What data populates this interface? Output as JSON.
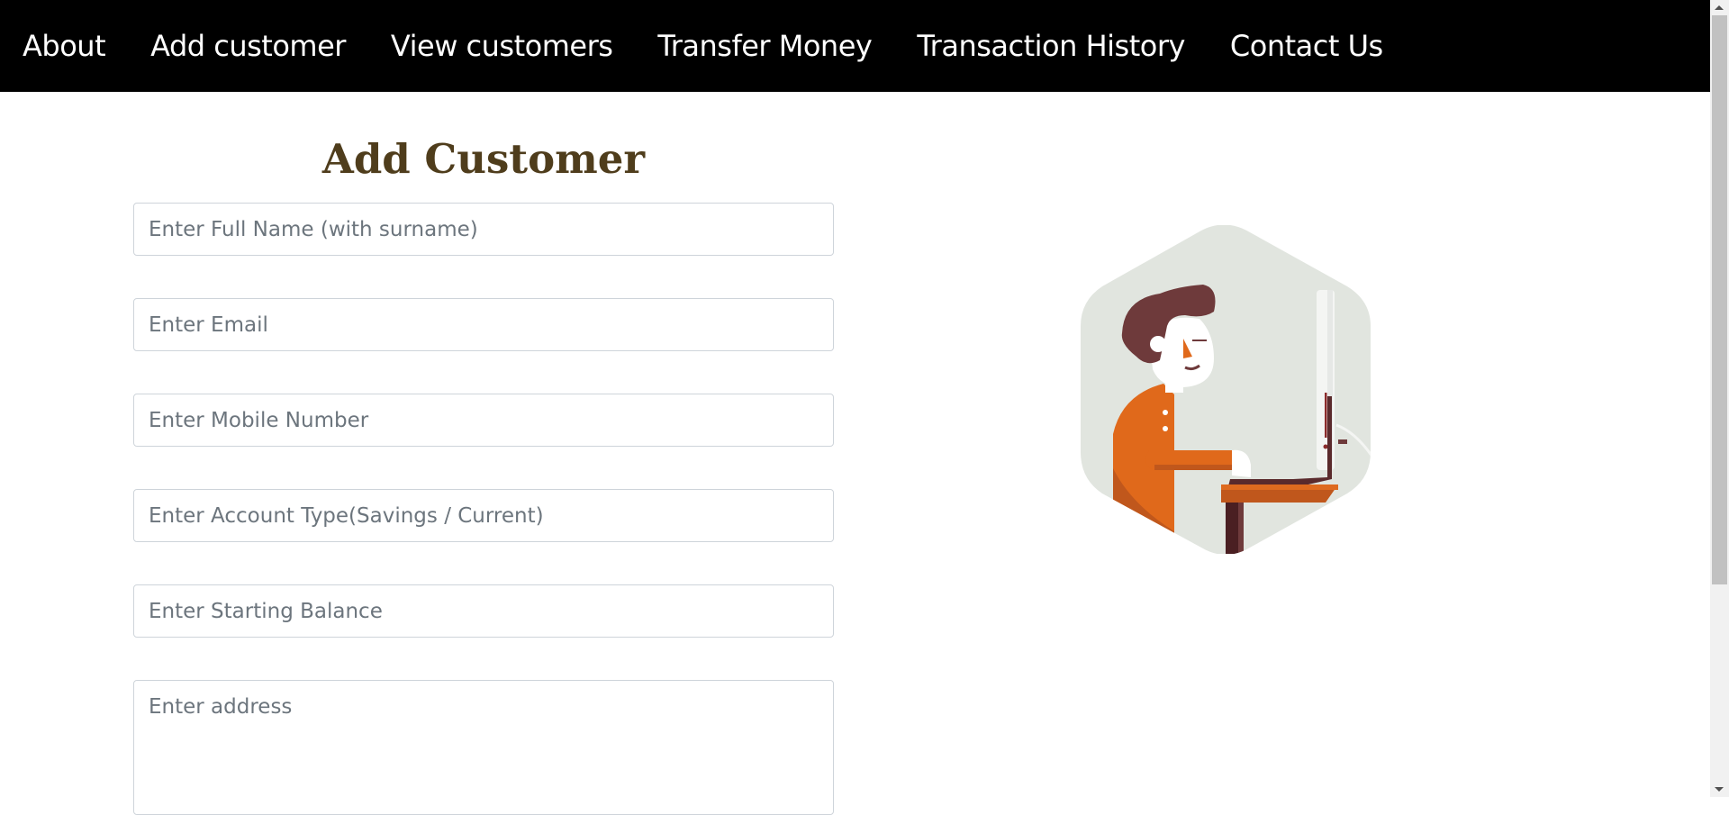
{
  "nav": {
    "items": [
      {
        "label": "About"
      },
      {
        "label": "Add customer"
      },
      {
        "label": "View customers"
      },
      {
        "label": "Transfer Money"
      },
      {
        "label": "Transaction History"
      },
      {
        "label": "Contact Us"
      }
    ]
  },
  "form": {
    "title": "Add Customer",
    "fields": {
      "full_name": {
        "placeholder": "Enter Full Name (with surname)",
        "value": ""
      },
      "email": {
        "placeholder": "Enter Email",
        "value": ""
      },
      "mobile": {
        "placeholder": "Enter Mobile Number",
        "value": ""
      },
      "account_type": {
        "placeholder": "Enter Account Type(Savings / Current)",
        "value": ""
      },
      "starting_balance": {
        "placeholder": "Enter Starting Balance",
        "value": ""
      },
      "address": {
        "placeholder": "Enter address",
        "value": ""
      }
    }
  },
  "illustration": {
    "icon": "person-at-computer-illustration",
    "colors": {
      "background": "#e1e5df",
      "shirt": "#e0691b",
      "hair": "#6e3a3b",
      "desk": "#c0571c",
      "desk_leg": "#4a1f22"
    }
  },
  "theme": {
    "navbar_bg": "#000000",
    "title_color": "#4f3d1c"
  }
}
